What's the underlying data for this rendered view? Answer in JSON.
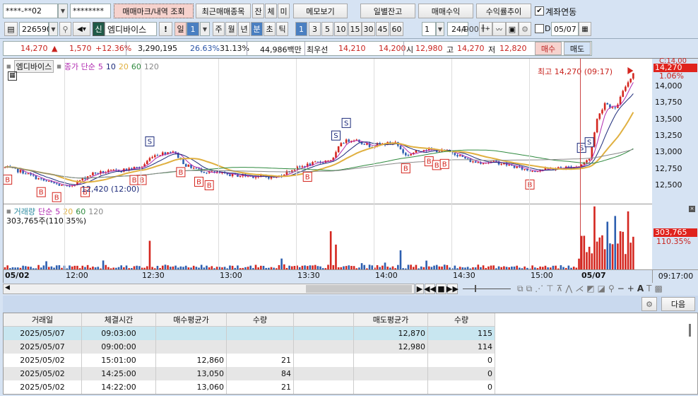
{
  "toolbar1": {
    "account": "****-**02",
    "password": "********",
    "mark_query": "매매마크/내역 조회",
    "recent": "최근매매종목",
    "jan": "잔",
    "che": "체",
    "mi": "미",
    "memo": "메모보기",
    "daily_balance": "일별잔고",
    "trade_profit": "매매수익",
    "profit_trend": "수익률추이",
    "link_account_label": "계좌연동",
    "link_account_checked": true
  },
  "toolbar2": {
    "code": "226590",
    "credit": "신",
    "name": "엠디바이스",
    "warn": "!",
    "day": "일",
    "day_num": "1",
    "week": "주",
    "month": "월",
    "year": "년",
    "minute": "분",
    "second": "초",
    "tick": "틱",
    "intervals": [
      "1",
      "3",
      "5",
      "10",
      "15",
      "30",
      "45",
      "60"
    ],
    "active_interval": "1",
    "multiplier": "1",
    "count": "244",
    "count_max": "/900",
    "d_label": "D",
    "date": "05/07"
  },
  "quote": {
    "price": "14,270",
    "arrow": "▲",
    "change": "1,570",
    "change_pct": "+12.36%",
    "volume": "3,290,195",
    "turnover1": "26.63%",
    "turnover2": "31.13%",
    "amount": "44,986백만",
    "best_label": "최우선",
    "ask": "14,210",
    "bid": "14,200",
    "open_label": "시",
    "open": "12,980",
    "high_label": "고",
    "high": "14,270",
    "low_label": "저",
    "low": "12,820",
    "buy": "매수",
    "sell": "매도"
  },
  "price_pane": {
    "name": "엠디바이스",
    "ma_label": "종가 단순",
    "ma_periods": [
      "5",
      "10",
      "20",
      "60",
      "120"
    ],
    "ma_colors": [
      "#b02ab0",
      "#1c2a7a",
      "#e0b040",
      "#2f8a3f",
      "#888888"
    ],
    "high_note": "최고 14,270 (09:17)",
    "low_note": "12,420 (12:00)",
    "current_tag": "14,270",
    "current_pct": "1.06%",
    "top_tick": "C:14,00"
  },
  "volume_pane": {
    "label": "거래량",
    "ma_label": "단순",
    "ma_periods": [
      "5",
      "20",
      "60",
      "120"
    ],
    "current": "303,765주(110.35%)",
    "tag": "303,765",
    "tag_pct": "110.35%"
  },
  "time_axis": {
    "labels": [
      "05/02",
      "12:00",
      "12:30",
      "13:00",
      "13:30",
      "14:00",
      "14:30",
      "15:00",
      "05/07"
    ],
    "current": "09:17:00"
  },
  "chart_data": {
    "type": "candlestick",
    "title": "엠디바이스 1분봉",
    "ylim": [
      12350,
      14330
    ],
    "yticks": [
      12500,
      12750,
      13000,
      13250,
      13500,
      13750,
      14000
    ],
    "ytick_labels": [
      "12,500",
      "12,750",
      "13,000",
      "13,250",
      "13,500",
      "13,750",
      "14,000"
    ],
    "keypoints_minute_index_price": [
      [
        0,
        12770
      ],
      [
        7,
        12700
      ],
      [
        14,
        12580
      ],
      [
        24,
        12470
      ],
      [
        34,
        12680
      ],
      [
        45,
        12730
      ],
      [
        53,
        12780
      ],
      [
        57,
        12950
      ],
      [
        65,
        13020
      ],
      [
        70,
        12800
      ],
      [
        78,
        12700
      ],
      [
        89,
        12650
      ],
      [
        105,
        12620
      ],
      [
        110,
        12720
      ],
      [
        116,
        12800
      ],
      [
        127,
        12900
      ],
      [
        130,
        13150
      ],
      [
        135,
        13200
      ],
      [
        141,
        13100
      ],
      [
        151,
        13150
      ],
      [
        155,
        12950
      ],
      [
        162,
        13050
      ],
      [
        173,
        13000
      ],
      [
        181,
        12850
      ],
      [
        190,
        12850
      ],
      [
        203,
        12720
      ],
      [
        214,
        12760
      ],
      [
        222,
        12790
      ],
      [
        226,
        12900
      ],
      [
        229,
        13500
      ],
      [
        232,
        13750
      ],
      [
        236,
        13650
      ],
      [
        240,
        14000
      ],
      [
        243,
        14200
      ]
    ],
    "volume_spikes_minute_index_value": [
      [
        56,
        150
      ],
      [
        126,
        200
      ],
      [
        128,
        130
      ],
      [
        153,
        100
      ],
      [
        228,
        330
      ],
      [
        233,
        250
      ],
      [
        236,
        280
      ],
      [
        238,
        200
      ],
      [
        241,
        304
      ]
    ],
    "markers": [
      {
        "t": 1,
        "k": "B"
      },
      {
        "t": 14,
        "k": "B"
      },
      {
        "t": 20,
        "k": "B"
      },
      {
        "t": 31,
        "k": "B"
      },
      {
        "t": 50,
        "k": "B"
      },
      {
        "t": 53,
        "k": "B"
      },
      {
        "t": 56,
        "k": "S"
      },
      {
        "t": 68,
        "k": "B"
      },
      {
        "t": 75,
        "k": "B"
      },
      {
        "t": 79,
        "k": "B"
      },
      {
        "t": 117,
        "k": "B"
      },
      {
        "t": 128,
        "k": "S"
      },
      {
        "t": 132,
        "k": "S"
      },
      {
        "t": 155,
        "k": "B"
      },
      {
        "t": 164,
        "k": "B"
      },
      {
        "t": 167,
        "k": "B"
      },
      {
        "t": 170,
        "k": "B"
      },
      {
        "t": 203,
        "k": "B"
      },
      {
        "t": 223,
        "k": "S"
      },
      {
        "t": 226,
        "k": "S"
      }
    ]
  },
  "table_bar": {
    "next": "다음"
  },
  "table": {
    "headers": [
      "거래일",
      "체결시간",
      "매수평균가",
      "수량",
      "",
      "매도평균가",
      "수량"
    ],
    "rows": [
      [
        "2025/05/07",
        "09:03:00",
        "",
        "",
        "",
        "12,870",
        "115"
      ],
      [
        "2025/05/07",
        "09:00:00",
        "",
        "",
        "",
        "12,980",
        "114"
      ],
      [
        "2025/05/02",
        "15:01:00",
        "12,860",
        "21",
        "",
        "",
        "0"
      ],
      [
        "2025/05/02",
        "14:25:00",
        "13,050",
        "84",
        "",
        "",
        "0"
      ],
      [
        "2025/05/02",
        "14:22:00",
        "13,060",
        "21",
        "",
        "",
        "0"
      ]
    ]
  }
}
